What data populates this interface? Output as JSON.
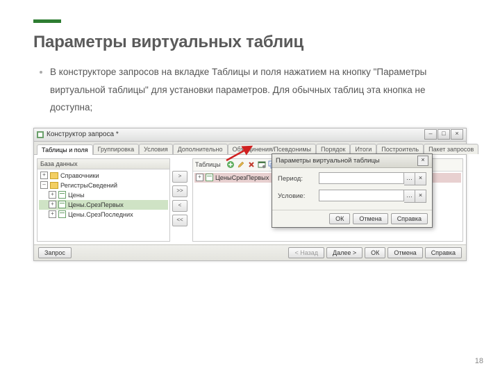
{
  "slide": {
    "title": "Параметры виртуальных таблиц",
    "bullet": "В конструкторе запросов на вкладке Таблицы и поля нажатием на кнопку \"Параметры виртуальной таблицы\" для установки параметров. Для обычных таблиц эта кнопка не доступна;",
    "page_number": "18"
  },
  "window": {
    "title": "Конструктор запроса *",
    "tabs": [
      "Таблицы и поля",
      "Группировка",
      "Условия",
      "Дополнительно",
      "Объединения/Псевдонимы",
      "Порядок",
      "Итоги",
      "Построитель",
      "Пакет запросов"
    ],
    "active_tab_index": 0,
    "db_pane": {
      "header": "База данных",
      "tree": [
        {
          "level": 0,
          "expand": "+",
          "icon": "folder",
          "label": "Справочники"
        },
        {
          "level": 0,
          "expand": "-",
          "icon": "folder",
          "label": "РегистрыСведений"
        },
        {
          "level": 1,
          "expand": "+",
          "icon": "table",
          "label": "Цены"
        },
        {
          "level": 1,
          "expand": "+",
          "icon": "table",
          "label": "Цены.СрезПервых",
          "selected": true
        },
        {
          "level": 1,
          "expand": "+",
          "icon": "table",
          "label": "Цены.СрезПоследних"
        }
      ]
    },
    "mid_buttons": [
      ">",
      ">>",
      "<",
      "<<"
    ],
    "tables_pane": {
      "header": "Таблицы",
      "toolbar_icons": [
        "add-icon",
        "edit-icon",
        "delete-x-icon",
        "vt-params-icon",
        "nested-icon",
        "replace-icon"
      ],
      "item": "ЦеныСрезПервых"
    },
    "footer": {
      "query_label": "Запрос",
      "buttons_left": [
        "< Назад",
        "Далее >",
        "ОК",
        "Отмена",
        "Справка"
      ]
    }
  },
  "dialog": {
    "title": "Параметры виртуальной таблицы",
    "fields": [
      {
        "label": "Период:"
      },
      {
        "label": "Условие:"
      }
    ],
    "buttons": [
      "ОК",
      "Отмена",
      "Справка"
    ]
  },
  "winbuttons": {
    "min": "–",
    "max": "□",
    "close": "×"
  }
}
